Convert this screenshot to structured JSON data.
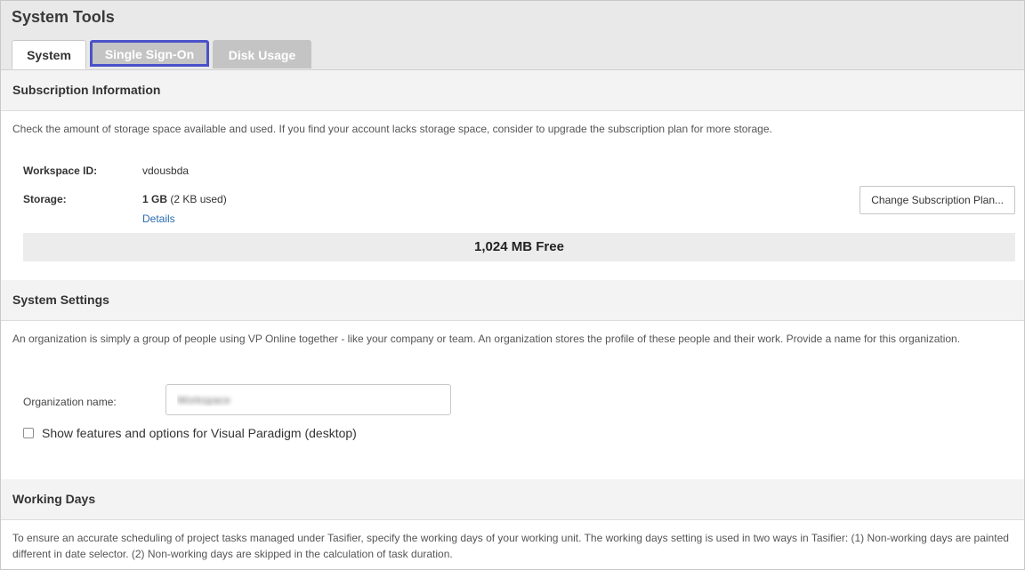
{
  "header": {
    "title": "System Tools",
    "tabs": [
      {
        "label": "System"
      },
      {
        "label": "Single Sign-On"
      },
      {
        "label": "Disk Usage"
      }
    ]
  },
  "subscription": {
    "heading": "Subscription Information",
    "description": "Check the amount of storage space available and used. If you find your account lacks storage space, consider to upgrade the subscription plan for more storage.",
    "workspace_label": "Workspace ID:",
    "workspace_value": "vdousbda",
    "storage_label": "Storage:",
    "storage_size": "1 GB",
    "storage_used": "(2 KB used)",
    "details_link": "Details",
    "change_button": "Change Subscription Plan...",
    "free_text": "1,024 MB Free"
  },
  "settings": {
    "heading": "System Settings",
    "description": "An organization is simply a group of people using VP Online together - like your company or team. An organization stores the profile of these people and their work. Provide a name for this organization.",
    "org_label": "Organization name:",
    "org_value": "Workspace",
    "checkbox_label": "Show features and options for Visual Paradigm (desktop)"
  },
  "working_days": {
    "heading": "Working Days",
    "description": "To ensure an accurate scheduling of project tasks managed under Tasifier, specify the working days of your working unit. The working days setting is used in two ways in Tasifier: (1) Non-working days are painted different in date selector. (2) Non-working days are skipped in the calculation of task duration."
  },
  "colors": {
    "accent": "#4a52c9",
    "link": "#2a6db0",
    "header_bg": "#e9e9e9"
  }
}
